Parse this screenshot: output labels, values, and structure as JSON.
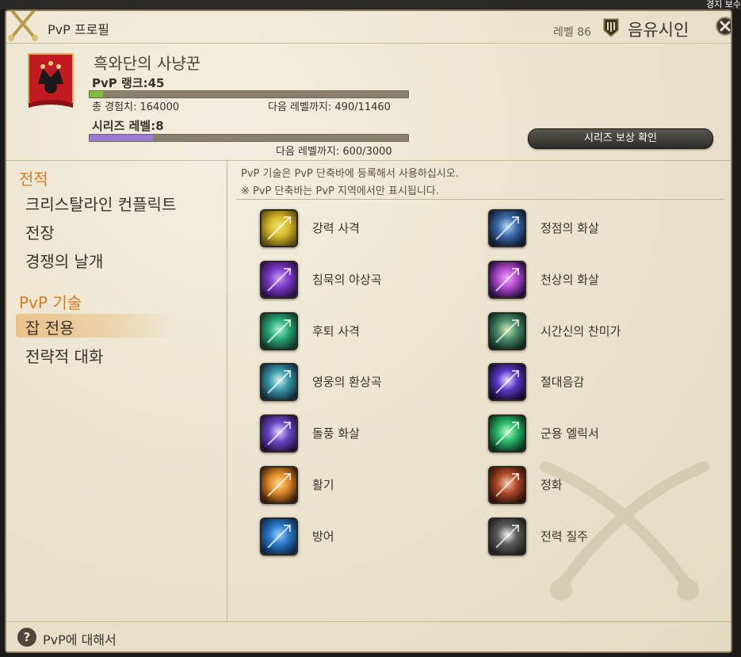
{
  "window": {
    "title": "PvP 프로필",
    "level_label": "레벨 86",
    "job_name": "음유시인"
  },
  "background_corner_text": "경지 보수",
  "profile": {
    "rank_title": "흑와단의 사냥꾼",
    "pvp_rank_label": "PvP 랭크:",
    "pvp_rank_value": "45",
    "rank_progress": 0.043,
    "total_exp": "총 경험치: 164000",
    "next_level_exp": "다음 레벨까지: 490/11460",
    "series_level_label": "시리즈 레벨:",
    "series_level_value": "8",
    "series_progress": 0.2,
    "series_next": "다음 레벨까지: 600/3000",
    "series_reward_button": "시리즈 보상 확인"
  },
  "sidebar": {
    "record_header": "전적",
    "record_items": [
      "크리스탈라인 컨플릭트",
      "전장",
      "경쟁의 날개"
    ],
    "skill_header": "PvP 기술",
    "skill_items": [
      "잡 전용",
      "전략적 대화"
    ],
    "active_item": "잡 전용"
  },
  "notes": [
    "PvP 기술은 PvP 단축바에 등록해서 사용하십시오.",
    "※ PvP 단축바는 PvP 지역에서만 표시됩니다."
  ],
  "skills_left": [
    {
      "label": "강력 사격",
      "icon": "power-shot-icon"
    },
    {
      "label": "침묵의 야상곡",
      "icon": "silent-nocturne-icon"
    },
    {
      "label": "후퇴 사격",
      "icon": "repelling-shot-icon"
    },
    {
      "label": "영웅의 환상곡",
      "icon": "heroes-fantasia-icon"
    },
    {
      "label": "돌풍 화살",
      "icon": "blast-arrow-icon"
    },
    {
      "label": "활기",
      "icon": "recuperate-icon"
    },
    {
      "label": "방어",
      "icon": "guard-icon"
    }
  ],
  "skills_right": [
    {
      "label": "정점의 화살",
      "icon": "apex-arrow-icon"
    },
    {
      "label": "천상의 화살",
      "icon": "empyreal-arrow-icon"
    },
    {
      "label": "시간신의 찬미가",
      "icon": "the-wardens-paean-icon"
    },
    {
      "label": "절대음감",
      "icon": "pitch-perfect-icon"
    },
    {
      "label": "군용 엘릭서",
      "icon": "standard-elixir-icon"
    },
    {
      "label": "정화",
      "icon": "purify-icon"
    },
    {
      "label": "전력 질주",
      "icon": "sprint-icon"
    }
  ],
  "footer": {
    "help_icon_glyph": "?",
    "help_text": "PvP에 대해서"
  },
  "colors": {
    "accent": "#e07a1e",
    "rank_bar": "#7fbf3e",
    "series_bar": "#9a7ad6"
  }
}
